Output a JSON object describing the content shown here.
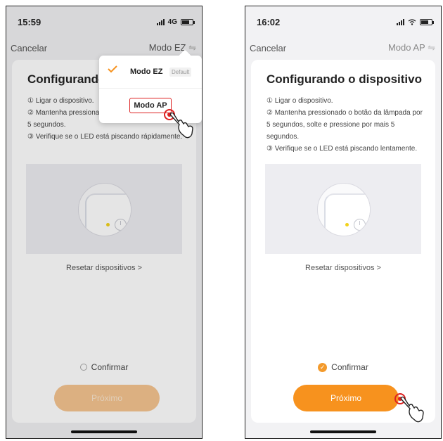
{
  "colors": {
    "accent": "#f7921e",
    "highlight": "#dd2222"
  },
  "left": {
    "status": {
      "time": "15:59",
      "network": "4G"
    },
    "nav": {
      "cancel": "Cancelar",
      "mode": "Modo EZ"
    },
    "dropdown": {
      "items": [
        {
          "label": "Modo EZ",
          "badge": "Default",
          "selected": true
        },
        {
          "label": "Modo AP",
          "selected": false
        }
      ]
    },
    "card": {
      "title": "Configurando o dispositivo",
      "steps": [
        "① Ligar o dispositivo.",
        "② Mantenha pressionado o botão da lâmpada por 5 segundos.",
        "③ Verifique se o LED está piscando rápidamente."
      ],
      "reset_link": "Resetar dispositivos >",
      "confirm_label": "Confirmar",
      "confirm_checked": false,
      "next_label": "Próximo"
    }
  },
  "right": {
    "status": {
      "time": "16:02"
    },
    "nav": {
      "cancel": "Cancelar",
      "mode": "Modo AP"
    },
    "card": {
      "title": "Configurando o dispositivo",
      "steps": [
        "① Ligar o dispositivo.",
        "② Mantenha pressionado o botão da lâmpada por 5 segundos, solte e pressione por mais 5 segundos.",
        "③ Verifique se o LED está piscando lentamente."
      ],
      "reset_link": "Resetar dispositivos >",
      "confirm_label": "Confirmar",
      "confirm_checked": true,
      "next_label": "Próximo"
    }
  }
}
